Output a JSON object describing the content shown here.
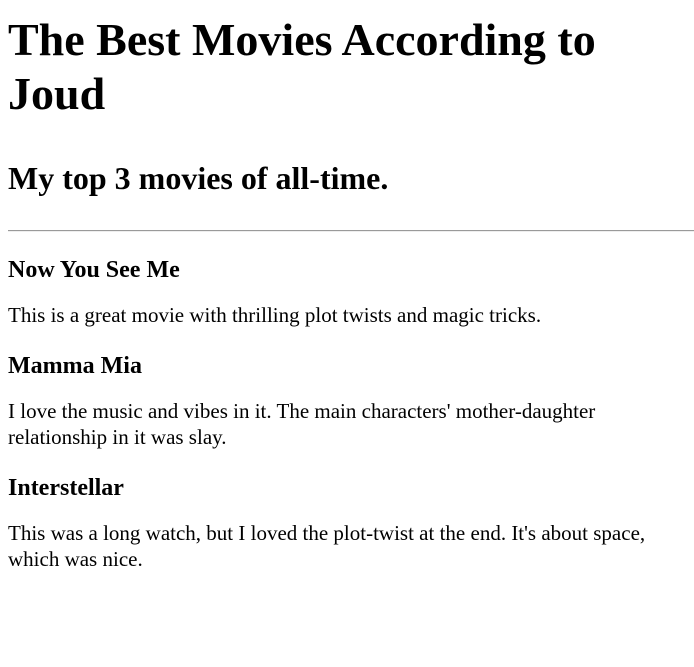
{
  "page": {
    "title": "The Best Movies According to Joud",
    "subtitle": "My top 3 movies of all-time."
  },
  "movies": [
    {
      "name": "Now You See Me",
      "description": "This is a great movie with thrilling plot twists and magic tricks."
    },
    {
      "name": "Mamma Mia",
      "description": "I love the music and vibes in it. The main characters' mother-daughter relationship in it was slay."
    },
    {
      "name": "Interstellar",
      "description": "This was a long watch, but I loved the plot-twist at the end. It's about space, which was nice."
    }
  ]
}
